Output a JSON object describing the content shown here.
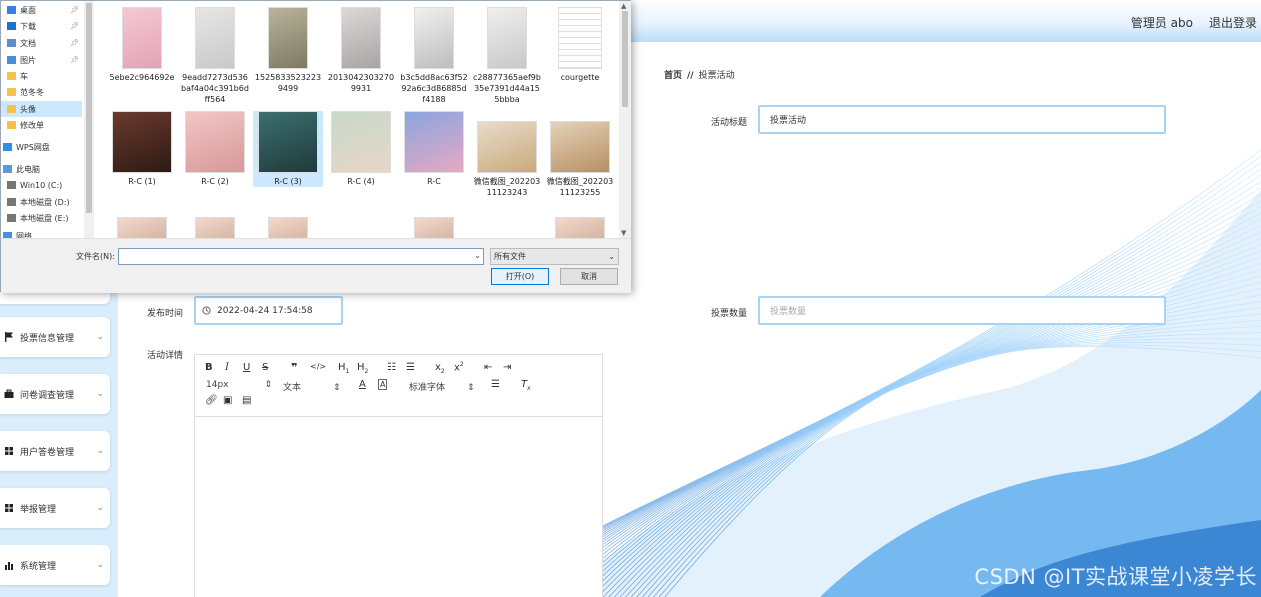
{
  "header": {
    "user": "管理员 abo",
    "logout": "退出登录"
  },
  "sidebar": {
    "items": [
      {
        "label": "投票信息管理",
        "icon": "flag-icon"
      },
      {
        "label": "问卷调查管理",
        "icon": "briefcase-icon"
      },
      {
        "label": "用户答卷管理",
        "icon": "grid-icon"
      },
      {
        "label": "举报管理",
        "icon": "grid-icon"
      },
      {
        "label": "系统管理",
        "icon": "bar-chart-icon"
      }
    ]
  },
  "breadcrumb": {
    "home": "首页",
    "sep": "//",
    "current": "投票活动"
  },
  "form": {
    "title_label": "活动标题",
    "title_value": "投票活动",
    "time_label": "发布时间",
    "time_value": "2022-04-24 17:54:58",
    "count_label": "投票数量",
    "count_placeholder": "投票数量",
    "detail_label": "活动详情"
  },
  "editor": {
    "font_size": "14px",
    "block_type": "文本",
    "font_family": "标准字体"
  },
  "dialog": {
    "nav": [
      {
        "label": "桌面",
        "pinned": true
      },
      {
        "label": "下载",
        "pinned": true
      },
      {
        "label": "文档",
        "pinned": true
      },
      {
        "label": "图片",
        "pinned": true
      },
      {
        "label": "车",
        "pinned": false
      },
      {
        "label": "范冬冬",
        "pinned": false
      },
      {
        "label": "头像",
        "pinned": false,
        "selected": true
      },
      {
        "label": "修改单",
        "pinned": false
      },
      {
        "label": "WPS网盘",
        "pinned": false
      },
      {
        "label": "此电脑",
        "pinned": false
      },
      {
        "label": "Win10 (C:)",
        "pinned": false
      },
      {
        "label": "本地磁盘 (D:)",
        "pinned": false
      },
      {
        "label": "本地磁盘 (E:)",
        "pinned": false
      },
      {
        "label": "网络",
        "pinned": false
      }
    ],
    "files": [
      "5ebe2c964692e",
      "9eadd7273d536baf4a04c391b6dff564",
      "15258335232239499",
      "20130423032709931",
      "b3c5dd8ac63f5292a6c3d86885df4188",
      "c28877365aef9b35e7391d44a155bbba",
      "courgette",
      "R-C (1)",
      "R-C (2)",
      "R-C (3)",
      "R-C (4)",
      "R-C",
      "微信截图_20220311123243",
      "微信截图_20220311123255"
    ],
    "filename_label": "文件名(N):",
    "filename_value": "",
    "filetype": "所有文件",
    "open": "打开(O)",
    "cancel": "取消"
  },
  "watermark": "CSDN @IT实战课堂小凌学长"
}
